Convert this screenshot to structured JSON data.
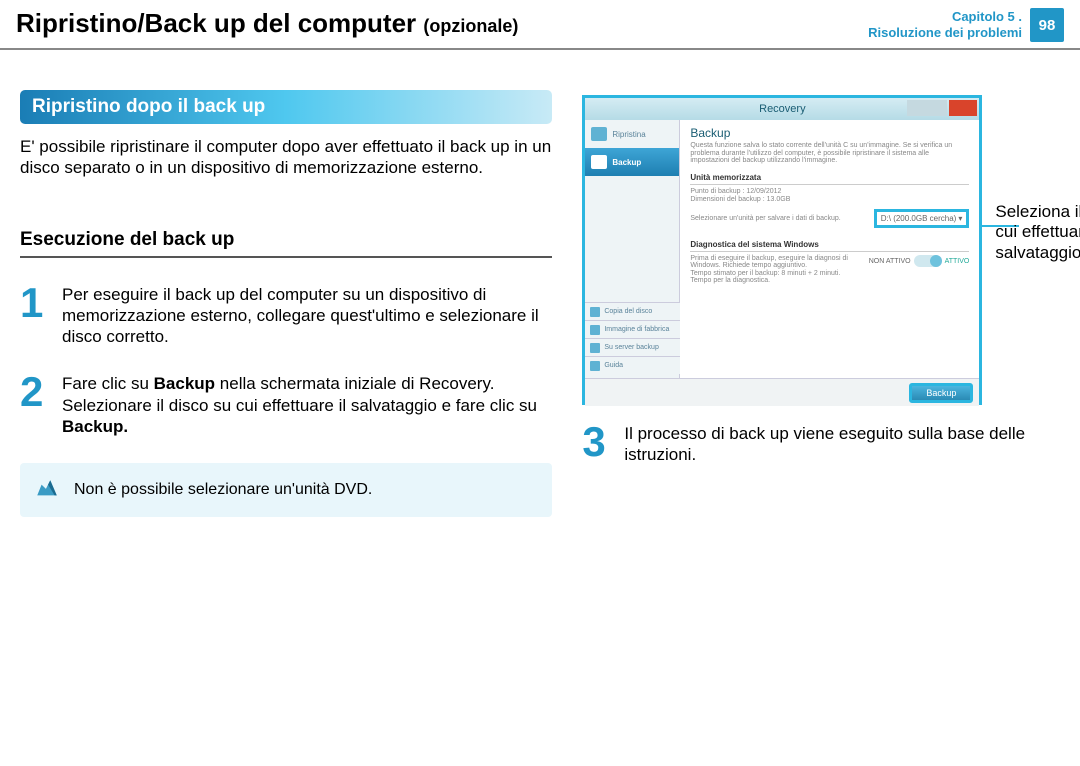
{
  "header": {
    "title": "Ripristino/Back up del computer",
    "optional_suffix": "(opzionale)",
    "chapter_line1": "Capitolo 5 .",
    "chapter_line2": "Risoluzione dei problemi",
    "page_number": "98"
  },
  "section_heading": "Ripristino dopo il back up",
  "intro_paragraph": "E' possibile ripristinare il computer dopo aver effettuato il back up in un disco separato o in un dispositivo di memorizzazione esterno.",
  "sub_heading": "Esecuzione del back up",
  "steps": [
    {
      "num": "1",
      "text": "Per eseguire il back up del computer su un dispositivo di memorizzazione esterno, collegare quest'ultimo e selezionare il disco corretto."
    },
    {
      "num": "2",
      "text_prefix": "Fare clic su ",
      "bold1": "Backup",
      "text_mid": " nella schermata iniziale di Recovery. Selezionare il disco su cui effettuare il salvataggio e fare clic su ",
      "bold2": "Backup.",
      "text_suffix": ""
    },
    {
      "num": "3",
      "text": "Il processo di back up viene eseguito sulla base delle istruzioni."
    }
  ],
  "note_text": "Non è possibile selezionare un'unità DVD.",
  "callout_text": "Seleziona il disco su cui effettuare il salvataggio.",
  "screenshot": {
    "window_title": "Recovery",
    "sidebar": [
      {
        "label": "Ripristina",
        "selected": false
      },
      {
        "label": "Backup",
        "selected": true
      }
    ],
    "sidebar_bottom": [
      "Copia del disco",
      "Immagine di fabbrica",
      "Su server backup",
      "Guida"
    ],
    "main_heading": "Backup",
    "main_desc": "Questa funzione salva lo stato corrente dell'unità C su un'immagine. Se si verifica un problema durante l'utilizzo del computer, è possibile ripristinare il sistema alle impostazioni del backup utilizzando l'immagine.",
    "section1_label": "Unità memorizzata",
    "info1": "Punto di backup : 12/09/2012",
    "info2": "Dimensioni del backup : 13.0GB",
    "info3": "Selezionare un'unità per salvare i dati di backup.",
    "disk_option": "D:\\ (200.0GB cercha)",
    "section2_label": "Diagnostica del sistema Windows",
    "diag_text1": "Prima di eseguire il backup, eseguire la diagnosi di Windows. Richiede tempo aggiuntivo.",
    "diag_text2": "Tempo stimato per il backup: 8 minuti + 2 minuti. Tempo per la diagnostica.",
    "toggle_off": "NON ATTIVO",
    "toggle_on": "ATTIVO",
    "primary_button": "Backup"
  }
}
